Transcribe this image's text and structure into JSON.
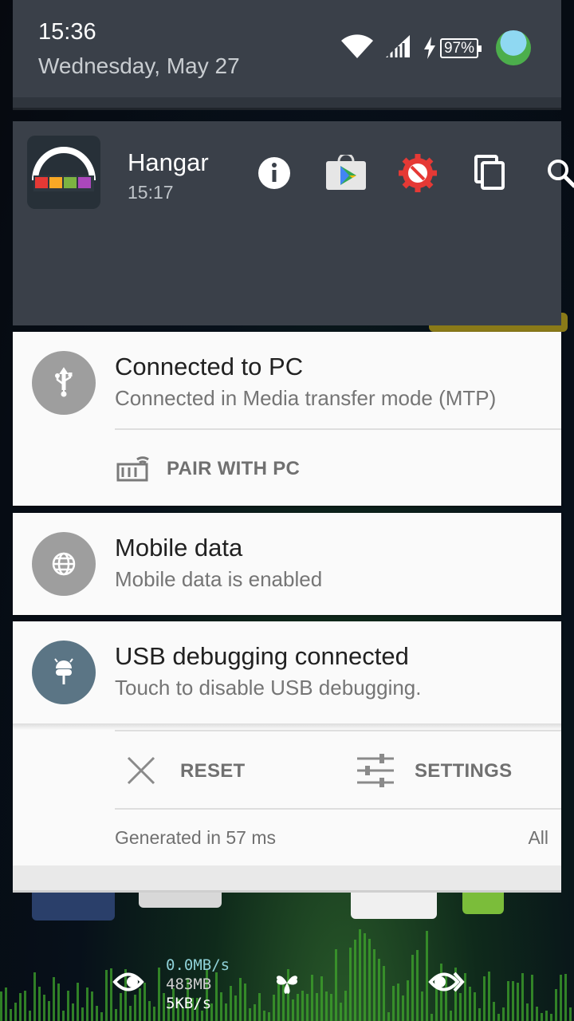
{
  "status_bar": {
    "time": "15:36",
    "date": "Wednesday, May 27",
    "battery": "97%"
  },
  "hangar": {
    "title": "Hangar",
    "time": "15:17",
    "icons": [
      "info-icon",
      "play-store-icon",
      "blocked-settings-icon",
      "copy-icon",
      "search-icon"
    ]
  },
  "connected_pc": {
    "title": "Connected to PC",
    "text": "Connected in Media transfer mode (MTP)",
    "action": "PAIR WITH PC"
  },
  "mobile_data": {
    "title": "Mobile data",
    "text": "Mobile data is enabled"
  },
  "usb_debugging": {
    "title": "USB debugging connected",
    "text": "Touch to disable USB debugging."
  },
  "bottom_actions": {
    "reset": "RESET",
    "settings": "SETTINGS"
  },
  "footer": {
    "generated": "Generated in 57 ms",
    "all": "All"
  },
  "net_monitor": {
    "speed_up": "0.0MB/s",
    "memory": "483MB",
    "speed_down": "5KB/s"
  },
  "colors": {
    "notification_bg": "#3a4049",
    "card_bg": "#fafafa",
    "usb_debug_circle": "#5b7585",
    "icon_circle": "#9e9e9e"
  }
}
